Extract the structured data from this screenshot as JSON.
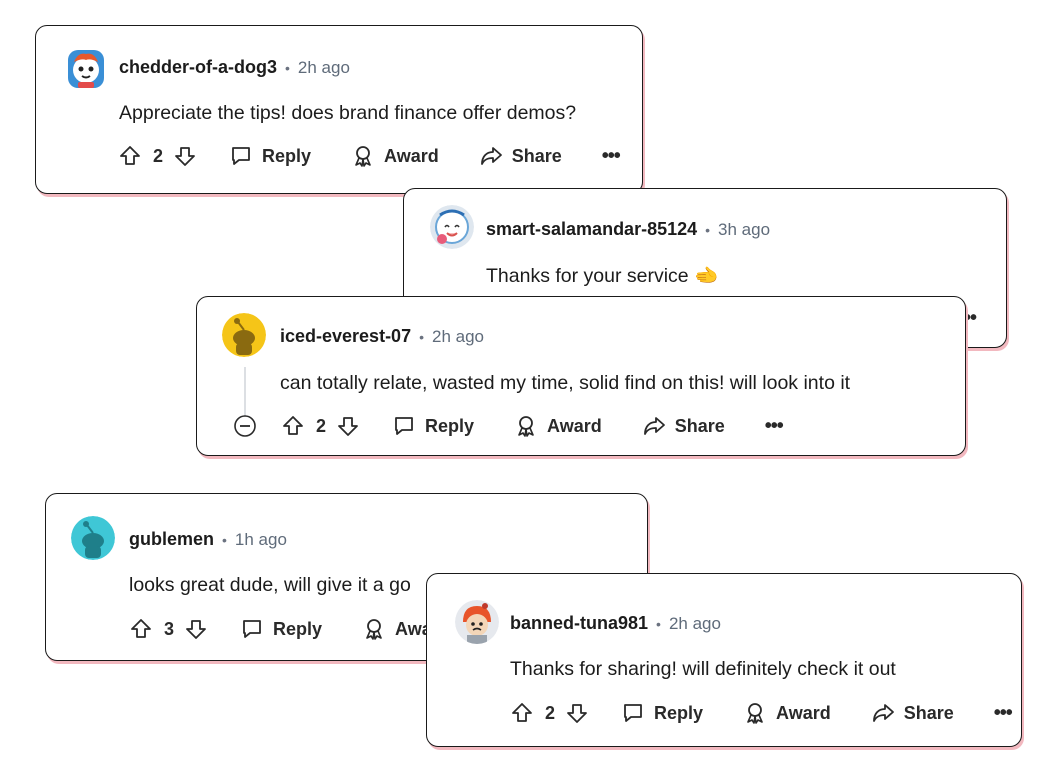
{
  "comments": [
    {
      "username": "chedder-of-a-dog3",
      "separator": "•",
      "time": "2h ago",
      "text": "Appreciate the tips! does brand finance offer demos?",
      "score": "2",
      "reply_label": "Reply",
      "award_label": "Award",
      "share_label": "Share",
      "more_label": "•••"
    },
    {
      "username": "smart-salamandar-85124",
      "separator": "•",
      "time": "3h ago",
      "text": "Thanks for your service 🫲",
      "more_label": "••"
    },
    {
      "username": "iced-everest-07",
      "separator": "•",
      "time": "2h ago",
      "text": "can totally relate, wasted my time, solid find on this! will look into it",
      "score": "2",
      "reply_label": "Reply",
      "award_label": "Award",
      "share_label": "Share",
      "more_label": "•••"
    },
    {
      "username": "gublemen",
      "separator": "•",
      "time": "1h ago",
      "text": "looks great dude, will give it a go",
      "score": "3",
      "reply_label": "Reply",
      "award_label": "Award"
    },
    {
      "username": "banned-tuna981",
      "separator": "•",
      "time": "2h ago",
      "text": "Thanks for sharing! will definitely check it out",
      "score": "2",
      "reply_label": "Reply",
      "award_label": "Award",
      "share_label": "Share",
      "more_label": "•••"
    }
  ],
  "icons": {
    "upvote": "upvote-icon",
    "downvote": "downvote-icon",
    "reply": "speech-bubble-icon",
    "award": "award-ribbon-icon",
    "share": "share-arrow-icon",
    "collapse": "collapse-minus-icon"
  },
  "colors": {
    "card_shadow": "#f2b8bf",
    "border": "#1a1a1a",
    "time_text": "#5f6b7a",
    "avatar_yellow": "#f5c518",
    "avatar_teal": "#3fc7d6"
  }
}
